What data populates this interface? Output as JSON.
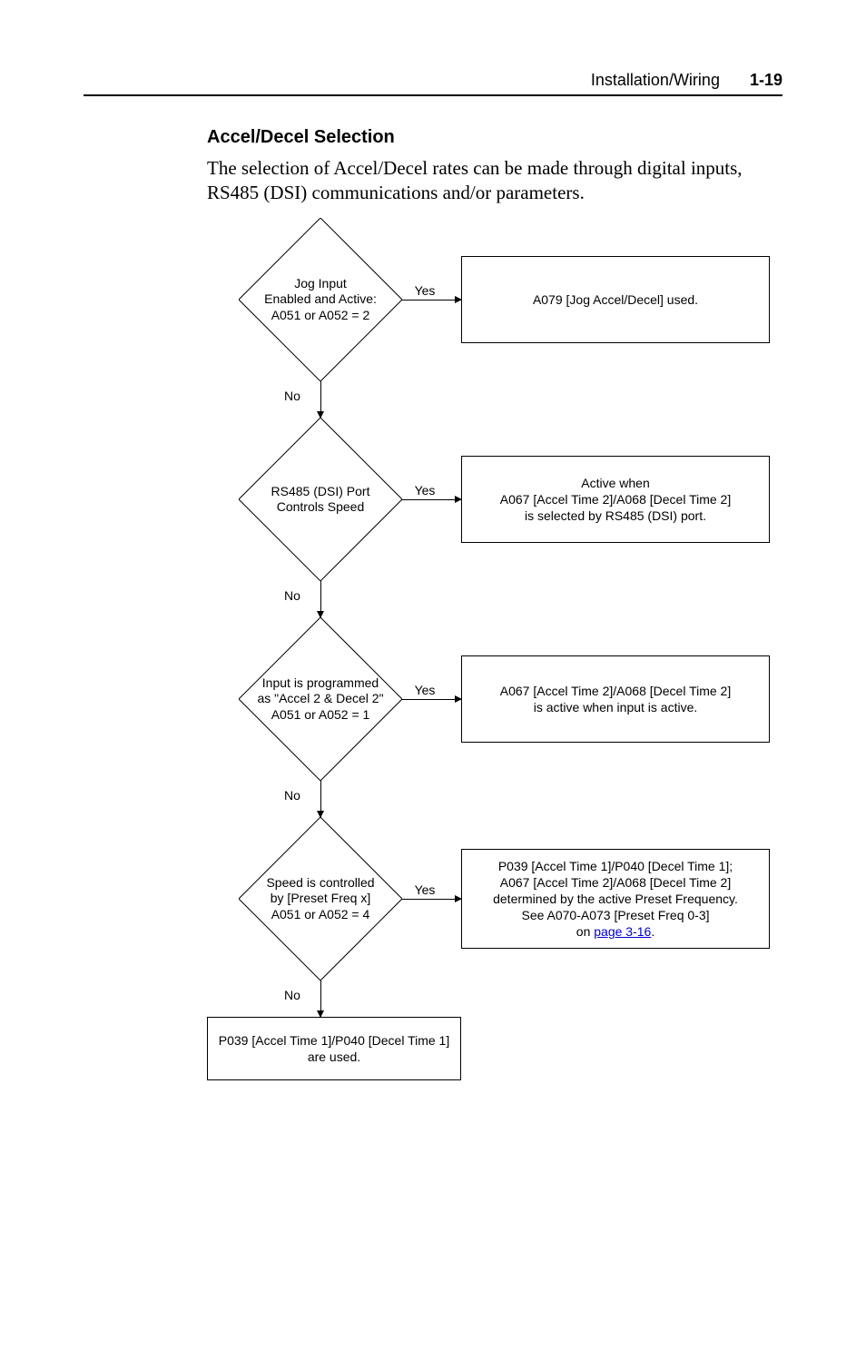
{
  "header": {
    "section": "Installation/Wiring",
    "page": "1-19"
  },
  "title": "Accel/Decel Selection",
  "body": "The selection of Accel/Decel rates can be made through digital inputs, RS485 (DSI) communications and/or parameters.",
  "flow": {
    "d1": "Jog Input\nEnabled and Active:\nA051 or A052 = 2",
    "b1": "A079 [Jog Accel/Decel] used.",
    "d2": "RS485 (DSI) Port\nControls Speed",
    "b2": "Active when\nA067 [Accel Time 2]/A068 [Decel Time 2]\nis selected by RS485 (DSI) port.",
    "d3": "Input is programmed\nas \"Accel 2 & Decel 2\"\nA051 or A052 = 1",
    "b3": "A067 [Accel Time 2]/A068 [Decel Time 2]\nis active when input is active.",
    "d4": "Speed is controlled\nby [Preset Freq x]\nA051 or A052 = 4",
    "b4a": "P039 [Accel Time 1]/P040 [Decel Time 1];\nA067 [Accel Time 2]/A068 [Decel Time 2]\ndetermined by the active Preset Frequency.\nSee A070-A073 [Preset Freq 0-3]\non ",
    "b4link": "page 3-16",
    "b5": "P039 [Accel Time 1]/P040 [Decel Time 1]\nare used.",
    "yes": "Yes",
    "no": "No"
  },
  "chart_data": {
    "type": "flowchart",
    "nodes": [
      {
        "id": "d1",
        "type": "decision",
        "text": "Jog Input Enabled and Active: A051 or A052 = 2"
      },
      {
        "id": "b1",
        "type": "process",
        "text": "A079 [Jog Accel/Decel] used."
      },
      {
        "id": "d2",
        "type": "decision",
        "text": "RS485 (DSI) Port Controls Speed"
      },
      {
        "id": "b2",
        "type": "process",
        "text": "Active when A067 [Accel Time 2]/A068 [Decel Time 2] is selected by RS485 (DSI) port."
      },
      {
        "id": "d3",
        "type": "decision",
        "text": "Input is programmed as \"Accel 2 & Decel 2\" A051 or A052 = 1"
      },
      {
        "id": "b3",
        "type": "process",
        "text": "A067 [Accel Time 2]/A068 [Decel Time 2] is active when input is active."
      },
      {
        "id": "d4",
        "type": "decision",
        "text": "Speed is controlled by [Preset Freq x] A051 or A052 = 4"
      },
      {
        "id": "b4",
        "type": "process",
        "text": "P039 [Accel Time 1]/P040 [Decel Time 1]; A067 [Accel Time 2]/A068 [Decel Time 2] determined by the active Preset Frequency. See A070-A073 [Preset Freq 0-3] on page 3-16."
      },
      {
        "id": "b5",
        "type": "process",
        "text": "P039 [Accel Time 1]/P040 [Decel Time 1] are used."
      }
    ],
    "edges": [
      {
        "from": "d1",
        "to": "b1",
        "label": "Yes"
      },
      {
        "from": "d1",
        "to": "d2",
        "label": "No"
      },
      {
        "from": "d2",
        "to": "b2",
        "label": "Yes"
      },
      {
        "from": "d2",
        "to": "d3",
        "label": "No"
      },
      {
        "from": "d3",
        "to": "b3",
        "label": "Yes"
      },
      {
        "from": "d3",
        "to": "d4",
        "label": "No"
      },
      {
        "from": "d4",
        "to": "b4",
        "label": "Yes"
      },
      {
        "from": "d4",
        "to": "b5",
        "label": "No"
      }
    ]
  }
}
